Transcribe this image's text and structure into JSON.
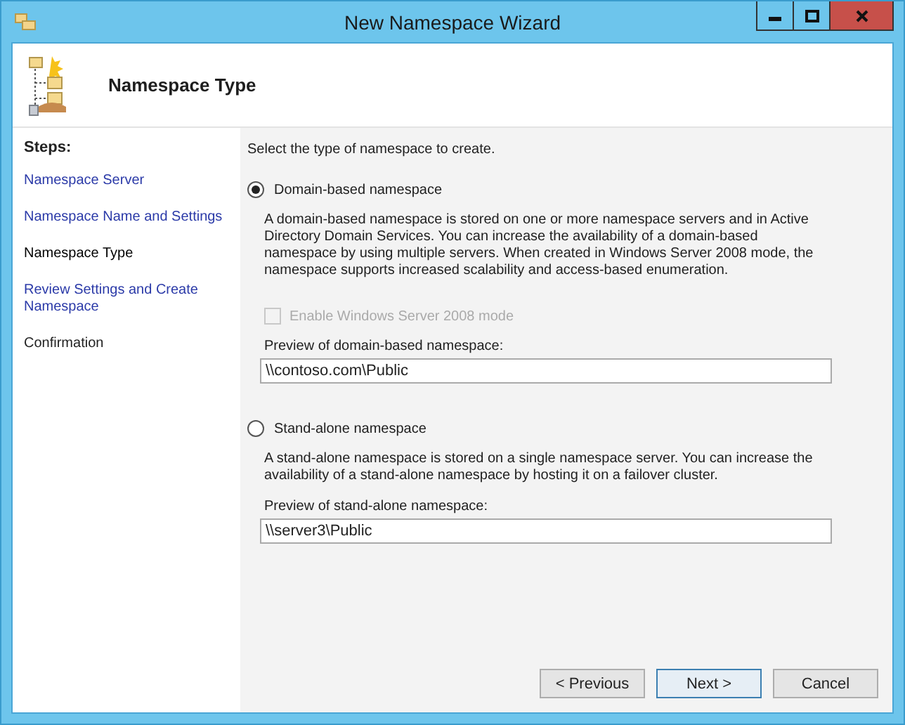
{
  "window": {
    "title": "New Namespace Wizard",
    "controls": [
      {
        "kind": "minimize"
      },
      {
        "kind": "maximize"
      },
      {
        "kind": "close"
      }
    ]
  },
  "header": {
    "title": "Namespace Type"
  },
  "steps": {
    "heading": "Steps:",
    "items": [
      {
        "label": "Namespace Server",
        "kind": "link",
        "selected": false
      },
      {
        "label": "Namespace Name and Settings",
        "kind": "link",
        "selected": false
      },
      {
        "label": "Namespace Type",
        "kind": "text",
        "selected": true
      },
      {
        "label": "Review Settings and Create Namespace",
        "kind": "link",
        "selected": false
      },
      {
        "label": "Confirmation",
        "kind": "text",
        "selected": false
      }
    ]
  },
  "content": {
    "instruction": "Select the type of namespace to create.",
    "options": [
      {
        "label": "Domain-based namespace",
        "selected": true,
        "description": "A domain-based namespace is stored on one or more namespace servers and in Active Directory Domain Services. You can increase the availability of a domain-based namespace by using multiple servers. When created in Windows Server 2008 mode, the namespace supports increased scalability and access-based enumeration.",
        "checkbox": {
          "label": "Enable Windows Server 2008 mode",
          "checked": false,
          "disabled": true
        },
        "preview_label": "Preview of domain-based namespace:",
        "preview_value": "\\\\contoso.com\\Public"
      },
      {
        "label": "Stand-alone namespace",
        "selected": false,
        "description": "A stand-alone namespace is stored on a single namespace server. You can increase the availability of a stand-alone namespace by hosting it on a failover cluster.",
        "preview_label": "Preview of stand-alone namespace:",
        "preview_value": "\\\\server3\\Public"
      }
    ]
  },
  "buttons": [
    {
      "label": "< Previous",
      "default": false
    },
    {
      "label": "Next >",
      "default": true
    },
    {
      "label": "Cancel",
      "default": false
    }
  ]
}
